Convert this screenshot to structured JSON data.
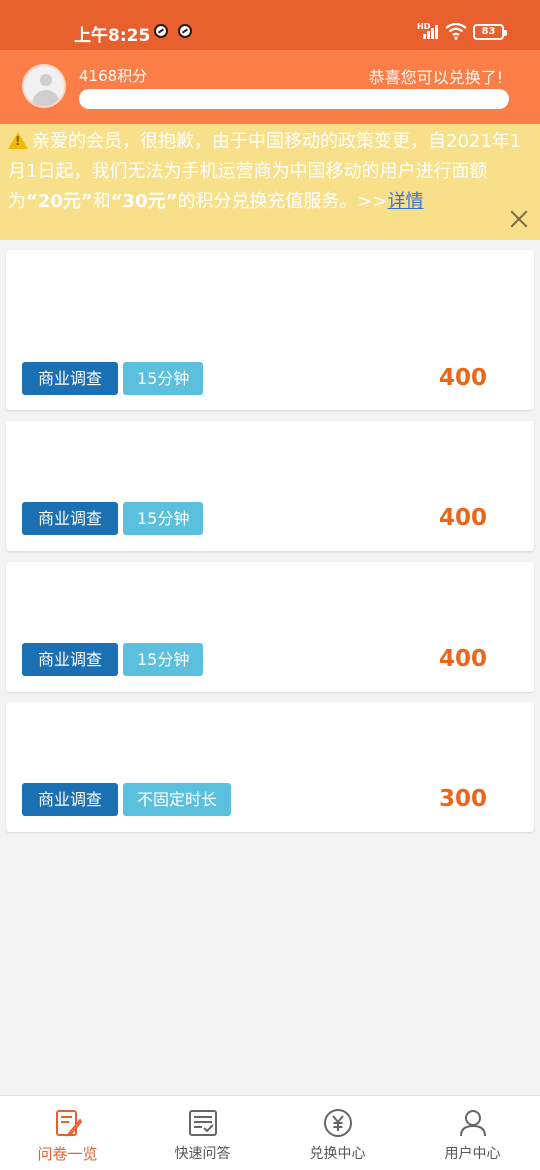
{
  "status": {
    "time": "上午8:25",
    "hd": "HD",
    "battery": "83"
  },
  "header": {
    "points": "4168积分",
    "congrats": "恭喜您可以兑换了!",
    "progress_fraction": 1.0
  },
  "notice": {
    "text_1": "亲爱的会员，很抱歉，由于中国移动的政策变更，自2021年1月1日起，我们无法为手机运营商为中国移动的用户进行面额为",
    "amount_1": "“20元”",
    "text_2": "和",
    "amount_2": "“30元”",
    "text_3": "的积分兑换充值服务。>>",
    "link": "详情"
  },
  "surveys": [
    {
      "category": "商业调查",
      "duration": "15分钟",
      "points": "400"
    },
    {
      "category": "商业调查",
      "duration": "15分钟",
      "points": "400"
    },
    {
      "category": "商业调查",
      "duration": "15分钟",
      "points": "400"
    },
    {
      "category": "商业调查",
      "duration": "不固定时长",
      "points": "300"
    }
  ],
  "tabs": [
    {
      "label": "问卷一览",
      "icon": "edit-doc-icon",
      "active": true
    },
    {
      "label": "快速问答",
      "icon": "checklist-icon",
      "active": false
    },
    {
      "label": "兑换中心",
      "icon": "yuan-coin-icon",
      "active": false
    },
    {
      "label": "用户中心",
      "icon": "user-icon",
      "active": false
    }
  ],
  "colors": {
    "status_bar": "#e8602e",
    "header": "#fb7d47",
    "notice_bg": "#f8e08b",
    "tag_category": "#1b6fb3",
    "tag_duration": "#5ac0dd",
    "points": "#e9661b",
    "active_tab": "#e8602e"
  }
}
